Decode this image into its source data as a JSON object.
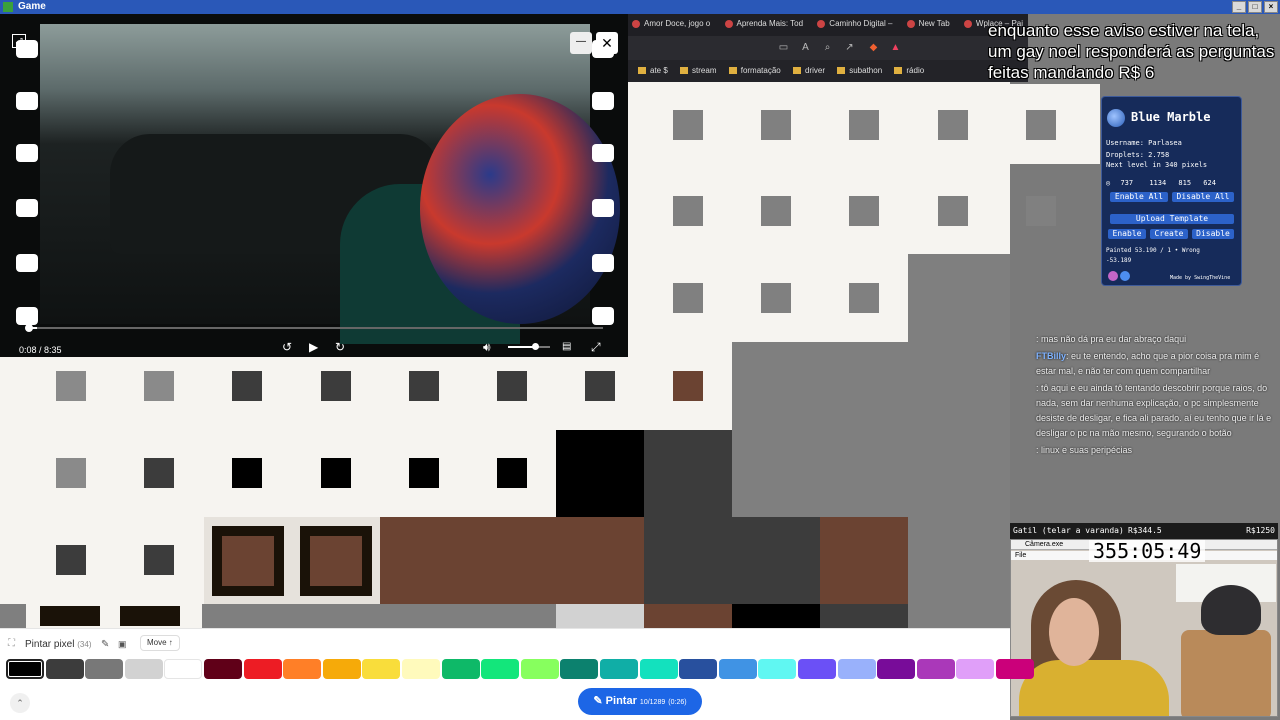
{
  "window": {
    "title": "Game"
  },
  "browser": {
    "tabs": [
      "Amor Doce, jogo o",
      "Aprenda Mais: Tod",
      "Caminho Digital –",
      "New Tab",
      "Wplace – Pai"
    ],
    "bookmarks": [
      "ate $",
      "stream",
      "formatação",
      "driver",
      "subathon",
      "rádio"
    ]
  },
  "video": {
    "time": "0:08 / 8:35",
    "progress": 0.016,
    "volume": 0.6
  },
  "subtitle": "enquanto esse aviso estiver na tela, um gay noel responderá as perguntas feitas mandando R$ 6",
  "blue_marble": {
    "title": "Blue Marble",
    "username": "Username: Parlasea",
    "droplets": "Droplets: 2.758",
    "next_level": "Next level in 340 pixels",
    "coords": [
      "737",
      "1134",
      "815",
      "624"
    ],
    "enable_all": "Enable All",
    "disable_all": "Disable All",
    "upload_template": "Upload Template",
    "enable": "Enable",
    "create": "Create",
    "disable": "Disable",
    "painted": "Painted 53.190 / 1 • Wrong",
    "wrong_val": "-53.189",
    "credit": "Made by SwingTheVine"
  },
  "chat": [
    {
      "user": "",
      "text": ": mas não dá pra eu dar abraço daqui"
    },
    {
      "user": "FTBilly",
      "text": ": eu te entendo, acho que a pior coisa pra mim é estar mal, e não ter com quem compartilhar"
    },
    {
      "user": "",
      "text": ": tô aqui e eu ainda tô tentando descobrir porque raios, do nada, sem dar nenhuma explicação, o pc simplesmente desiste de desligar, e fica ali parado. aí eu tenho que ir lá e desligar o pc na mão mesmo, segurando o botão"
    },
    {
      "user": "",
      "text": ": linux e suas peripécias"
    }
  ],
  "stream_goal": {
    "label": "Gatil (telar a varanda)",
    "current": "R$344.5",
    "target": "R$1250"
  },
  "webcam": {
    "title": "Câmera.exe",
    "menu": "File",
    "timer": "355:05:49"
  },
  "bottom": {
    "paint_pixel": "Pintar pixel",
    "paint_count": "(34)",
    "move": "Move ↑",
    "paint_button": "Pintar",
    "paint_charges": "10/1289",
    "paint_timer": "(0:26)"
  },
  "palette": [
    "#000000",
    "#3c3c3c",
    "#787878",
    "#d2d2d2",
    "#ffffff",
    "#600018",
    "#ed1c24",
    "#ff7f27",
    "#f6aa09",
    "#f9dd3b",
    "#fffabc",
    "#0eb968",
    "#13e67b",
    "#87ff5e",
    "#0c816e",
    "#10aea6",
    "#13e1be",
    "#28509e",
    "#4093e4",
    "#60f7f2",
    "#6b50f6",
    "#99b1fb",
    "#780c99",
    "#aa38b9",
    "#e09ff9",
    "#cb007a"
  ]
}
